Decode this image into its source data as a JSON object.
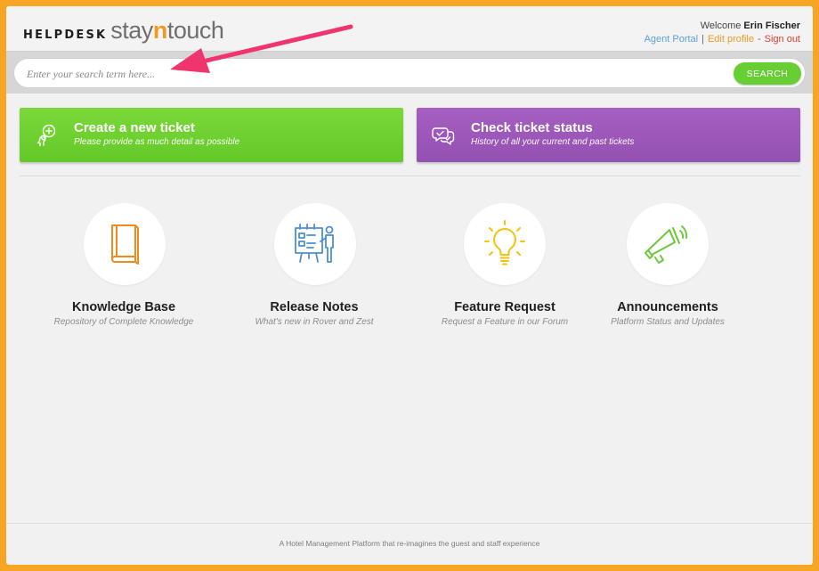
{
  "header": {
    "logo_helpdesk": "HELPDESK",
    "logo_stay": "stay",
    "logo_n": "n",
    "logo_touch": "touch",
    "welcome_prefix": "Welcome",
    "user_name": "Erin Fischer",
    "links": {
      "agent_portal": "Agent Portal",
      "sep1": "|",
      "edit_profile": "Edit profile",
      "sep2": "-",
      "sign_out": "Sign out"
    }
  },
  "search": {
    "placeholder": "Enter your search term here...",
    "value": "",
    "button_label": "SEARCH"
  },
  "cards": {
    "create": {
      "title": "Create a new ticket",
      "subtitle": "Please provide as much detail as possible",
      "icon": "person-plus-icon"
    },
    "status": {
      "title": "Check ticket status",
      "subtitle": "History of all your current and past tickets",
      "icon": "chat-check-icon"
    }
  },
  "features": [
    {
      "title": "Knowledge Base",
      "subtitle": "Repository of Complete Knowledge",
      "icon": "book-icon"
    },
    {
      "title": "Release Notes",
      "subtitle": "What's new in Rover and Zest",
      "icon": "presentation-board-icon"
    },
    {
      "title": "Feature Request",
      "subtitle": "Request a Feature in our Forum",
      "icon": "lightbulb-icon"
    },
    {
      "title": "Announcements",
      "subtitle": "Platform Status and Updates",
      "icon": "megaphone-icon"
    }
  ],
  "footer": {
    "tagline": "A Hotel Management Platform that re-imagines the guest and staff experience"
  },
  "colors": {
    "frame": "#f7a524",
    "create_card": "#6ccf2f",
    "status_card": "#9c57b9",
    "search_button": "#67cf34",
    "agent_portal": "#5aa3d8",
    "edit_profile": "#f29a1f",
    "sign_out": "#e03c2f",
    "annotation_arrow": "#f0346e"
  }
}
